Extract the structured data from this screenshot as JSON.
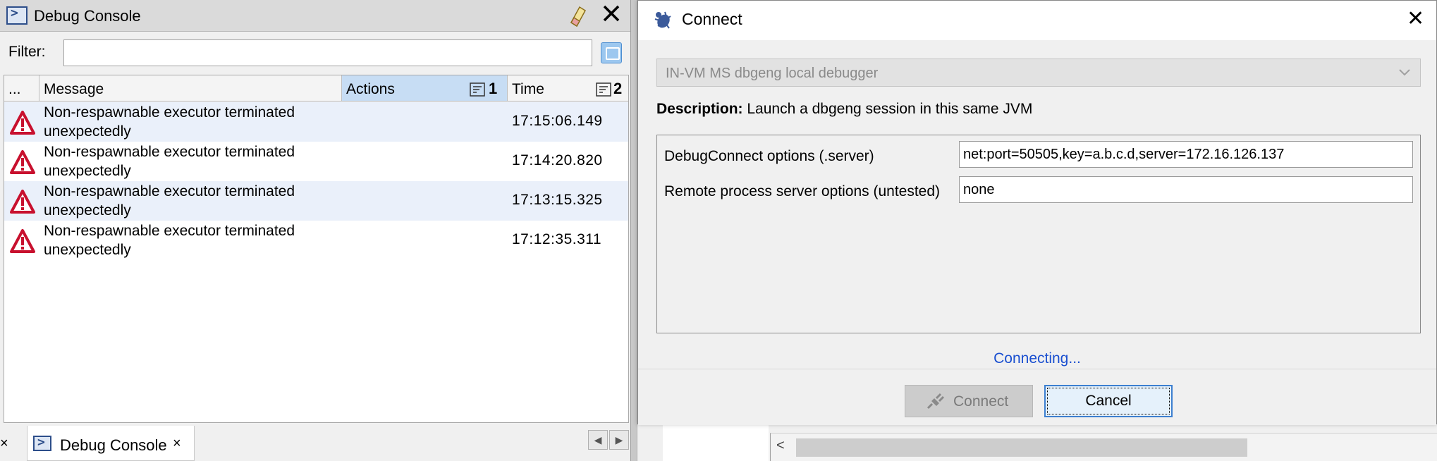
{
  "debug_console": {
    "title": "Debug Console",
    "filter_label": "Filter:",
    "filter_value": "",
    "columns": {
      "more": "...",
      "message": "Message",
      "actions": "Actions",
      "actions_sort": "1",
      "time": "Time",
      "time_sort": "2"
    },
    "rows": [
      {
        "message": "Non-respawnable executor terminated unexpectedly",
        "time": "17:15:06.149"
      },
      {
        "message": "Non-respawnable executor terminated unexpectedly",
        "time": "17:14:20.820"
      },
      {
        "message": "Non-respawnable executor terminated unexpectedly",
        "time": "17:13:15.325"
      },
      {
        "message": "Non-respawnable executor terminated unexpectedly",
        "time": "17:12:35.311"
      }
    ],
    "bottom_tab_label": "Debug Console",
    "close_glyph": "×"
  },
  "connect_dialog": {
    "title": "Connect",
    "close_glyph": "✕",
    "debugger_select": "IN-VM MS dbgeng local debugger",
    "description_label": "Description:",
    "description_text": "Launch a dbgeng session in this same JVM",
    "options": [
      {
        "label": "DebugConnect options (.server)",
        "value": "net:port=50505,key=a.b.c.d,server=172.16.126.137"
      },
      {
        "label": "Remote process server options (untested)",
        "value": "none"
      }
    ],
    "status": "Connecting...",
    "connect_button": "Connect",
    "cancel_button": "Cancel"
  },
  "background": {
    "scroll_left_glyph": "<"
  },
  "colors": {
    "selected_header": "#c7ddf4",
    "alt_row": "#eaf0fa",
    "status_blue": "#1a4fd0",
    "focus_border": "#3c7fd0",
    "warning_red": "#c8102e"
  },
  "icons": [
    "console-icon",
    "clear-eraser-icon",
    "close-icon",
    "filter-apply-icon",
    "sort-icon",
    "warning-icon",
    "bug-icon",
    "chevron-down-icon",
    "disconnect-plug-icon"
  ]
}
